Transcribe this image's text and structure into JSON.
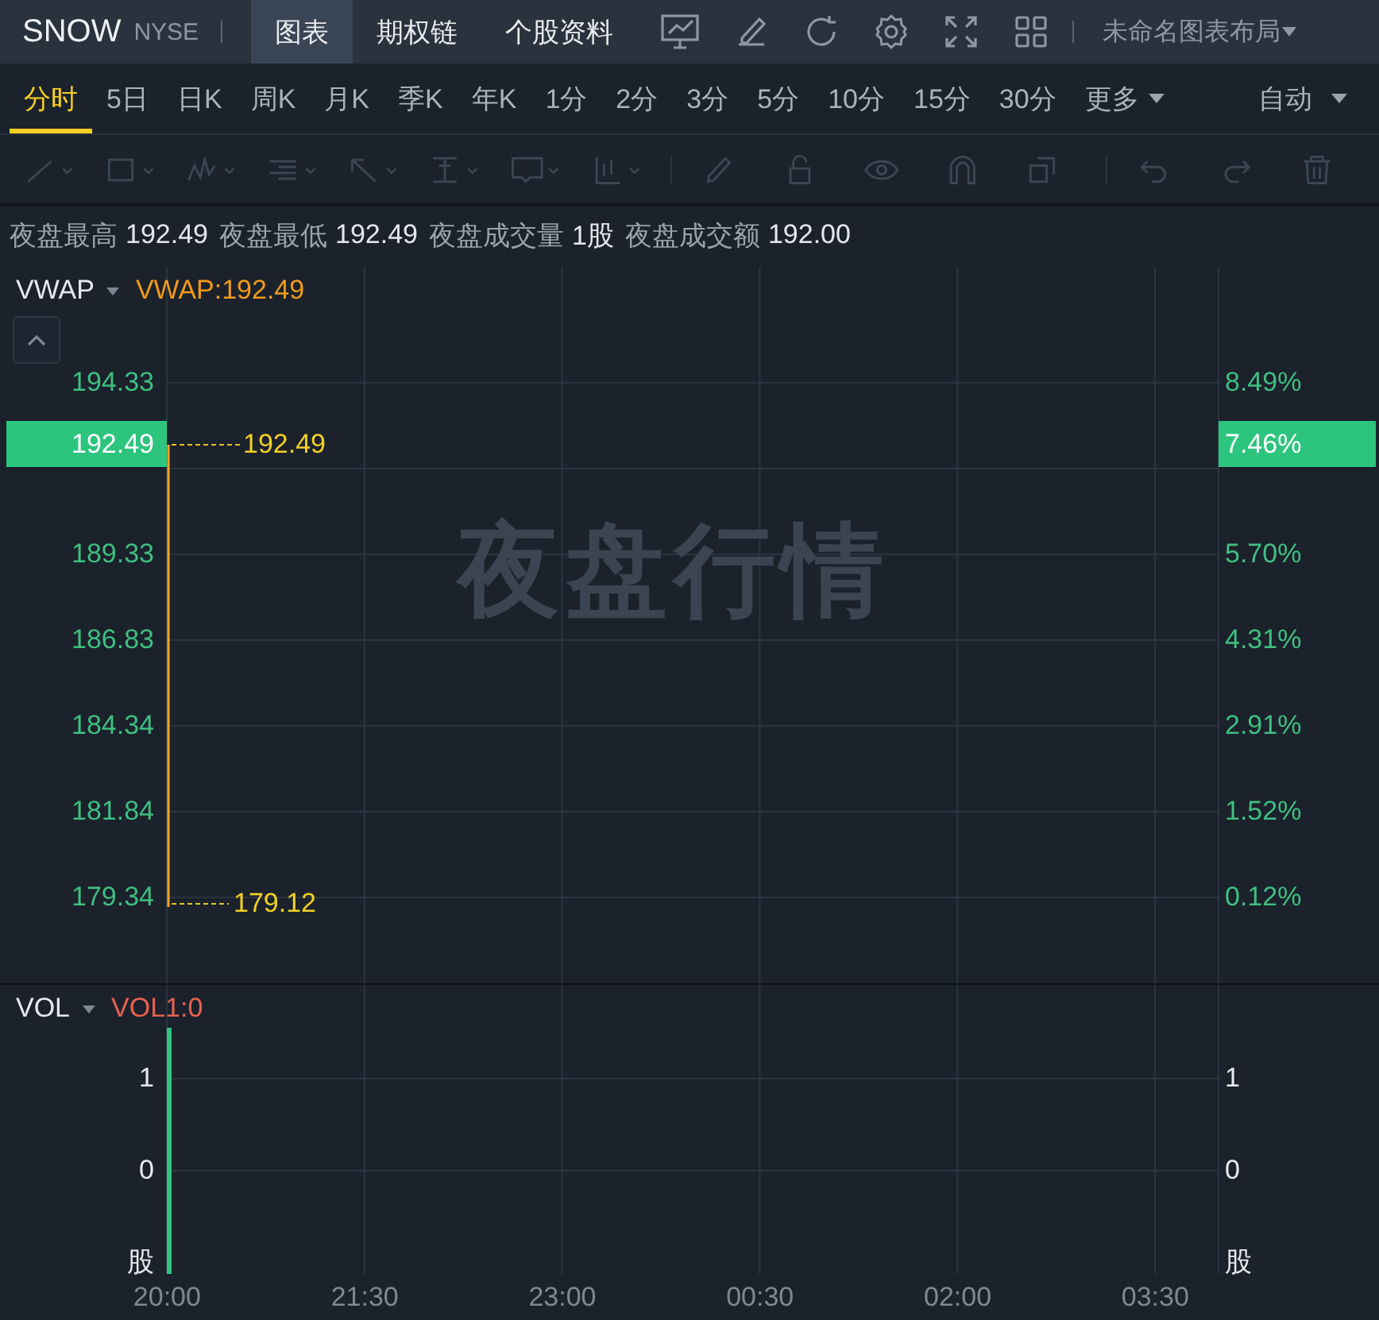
{
  "header": {
    "symbol": "SNOW",
    "exchange": "NYSE",
    "tabs": [
      {
        "label": "图表",
        "selected": true
      },
      {
        "label": "期权链",
        "selected": false
      },
      {
        "label": "个股资料",
        "selected": false
      }
    ],
    "layout_menu": "未命名图表布局"
  },
  "periods": [
    {
      "label": "分时",
      "selected": true,
      "dropdown": false
    },
    {
      "label": "5日",
      "selected": false,
      "dropdown": false
    },
    {
      "label": "日K",
      "selected": false,
      "dropdown": false
    },
    {
      "label": "周K",
      "selected": false,
      "dropdown": false
    },
    {
      "label": "月K",
      "selected": false,
      "dropdown": false
    },
    {
      "label": "季K",
      "selected": false,
      "dropdown": false
    },
    {
      "label": "年K",
      "selected": false,
      "dropdown": false
    },
    {
      "label": "1分",
      "selected": false,
      "dropdown": false
    },
    {
      "label": "2分",
      "selected": false,
      "dropdown": false
    },
    {
      "label": "3分",
      "selected": false,
      "dropdown": false
    },
    {
      "label": "5分",
      "selected": false,
      "dropdown": false
    },
    {
      "label": "10分",
      "selected": false,
      "dropdown": false
    },
    {
      "label": "15分",
      "selected": false,
      "dropdown": false
    },
    {
      "label": "30分",
      "selected": false,
      "dropdown": false
    },
    {
      "label": "更多",
      "selected": false,
      "dropdown": true
    }
  ],
  "mode_menu": "自动",
  "night_stats": [
    {
      "label": "夜盘最高",
      "value": "192.49"
    },
    {
      "label": "夜盘最低",
      "value": "192.49"
    },
    {
      "label": "夜盘成交量",
      "value": "1股"
    },
    {
      "label": "夜盘成交额",
      "value": "192.00"
    }
  ],
  "price_chart": {
    "indicator": "VWAP",
    "indicator_value": "VWAP:192.49",
    "watermark": "夜盘行情",
    "left_ticks": [
      "194.33",
      "189.33",
      "186.83",
      "184.34",
      "181.84",
      "179.34"
    ],
    "right_ticks": [
      "8.49%",
      "5.70%",
      "4.31%",
      "2.91%",
      "1.52%",
      "0.12%"
    ],
    "price_badge": "192.49",
    "percent_badge": "7.46%",
    "high_label": "192.49",
    "low_label": "179.12"
  },
  "volume_chart": {
    "indicator": "VOL",
    "indicator_value": "VOL1:0",
    "left_ticks": [
      "1",
      "0",
      "股"
    ],
    "right_ticks": [
      "1",
      "0",
      "股"
    ]
  },
  "time_axis": [
    "20:00",
    "21:30",
    "23:00",
    "00:30",
    "02:00",
    "03:30"
  ]
}
